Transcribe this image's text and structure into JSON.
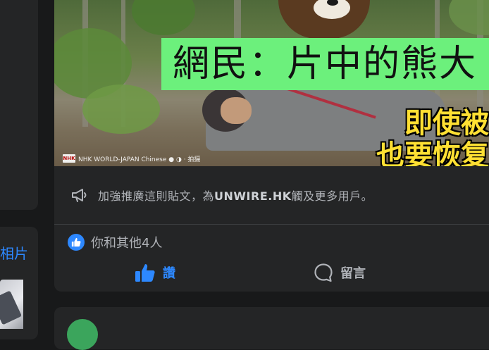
{
  "sidebar": {
    "photos_label": "相片"
  },
  "post": {
    "video": {
      "banner_text": "網民：片中的熊大",
      "subtitle_line1": "即使被",
      "subtitle_line2": "也要恢复",
      "watermark_logo": "NHK",
      "watermark_text": "NHK WORLD-JAPAN Chinese ● ◑ · 拍摄"
    },
    "boost": {
      "prefix": "加強推廣這則貼文，為",
      "page_name": "UNWIRE.HK",
      "suffix": "觸及更多用戶。",
      "icon": "megaphone-icon"
    },
    "reactions": {
      "summary": "你和其他4人",
      "icon": "like-reaction-icon"
    },
    "actions": {
      "like_label": "讚",
      "comment_label": "留言"
    }
  },
  "colors": {
    "background": "#18191a",
    "card": "#242526",
    "accent_blue": "#2d88ff",
    "secondary_text": "#b0b3b8",
    "banner_green": "#6cf07c",
    "subtitle_yellow": "#ffe033"
  }
}
